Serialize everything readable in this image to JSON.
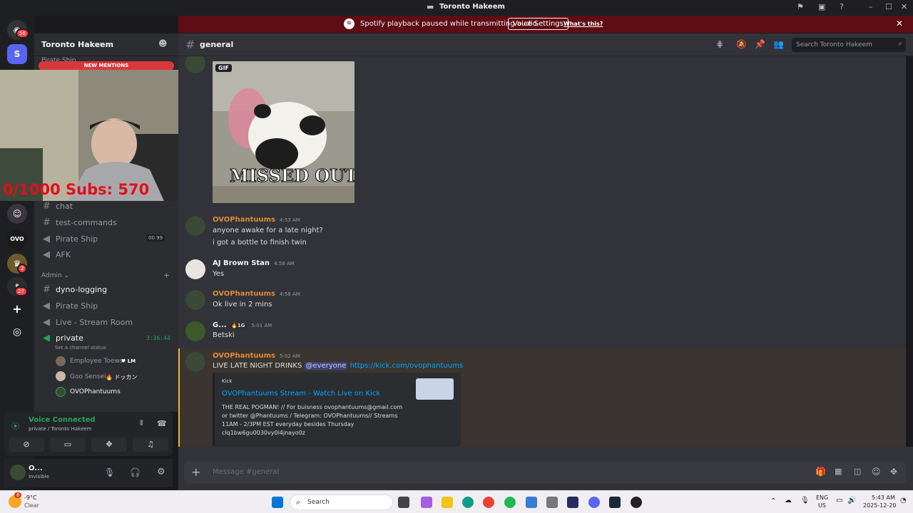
{
  "window": {
    "title": "Toronto Hakeem"
  },
  "banner": {
    "message": "Spotify playback paused while transmitting audio.",
    "button": "Voice Settings",
    "link": "What's this?"
  },
  "rail": {
    "badges": [
      "56",
      "2",
      "27"
    ]
  },
  "server": {
    "name": "Toronto Hakeem",
    "new_mentions": "NEW MENTIONS",
    "partial_label": "Pirate Ship"
  },
  "webcam": {
    "overlay_text": "0/1000 Subs: 570"
  },
  "channels": {
    "upper": [
      {
        "name": "chat",
        "type": "text"
      },
      {
        "name": "test-commands",
        "type": "text"
      },
      {
        "name": "Pirate Ship",
        "type": "voice",
        "count_a": "00",
        "count_b": "99"
      },
      {
        "name": "AFK",
        "type": "voice"
      }
    ],
    "admin_category": "Admin",
    "admin": [
      {
        "name": "dyno-logging",
        "type": "text"
      },
      {
        "name": "Pirate Ship",
        "type": "voice"
      },
      {
        "name": "Live - Stream Room",
        "type": "voice"
      },
      {
        "name": "private",
        "type": "voice",
        "timer": "3:36:44"
      }
    ],
    "set_status": "Set a channel status",
    "voice_users": [
      {
        "name": "Employee Toews",
        "tag": "LM"
      },
      {
        "name": "Goo Sensei",
        "tag": "ドッカン"
      },
      {
        "name": "OVOPhantuums",
        "tag": ""
      }
    ]
  },
  "voice_panel": {
    "status": "Voice Connected",
    "location": "private / Toronto Hakeem"
  },
  "user_panel": {
    "name": "O...",
    "status": "Invisible"
  },
  "channel": {
    "name": "general",
    "search_placeholder": "Search Toronto Hakeem",
    "composer_placeholder": "Message #general"
  },
  "messages": [
    {
      "author": "OVOPhantuums",
      "time": "4:53 AM",
      "lines": [
        "anyone awake for a late night?",
        "i got a bottle to finish twin"
      ],
      "color": "#e08a3a"
    },
    {
      "author": "AJ Brown Stan",
      "time": "4:58 AM",
      "lines": [
        "Yes"
      ],
      "color": "#f2f3f5"
    },
    {
      "author": "OVOPhantuums",
      "time": "4:58 AM",
      "lines": [
        "Ok live in 2 mins"
      ],
      "color": "#e08a3a"
    },
    {
      "author": "G...",
      "time": "5:01 AM",
      "tag": "1G",
      "lines": [
        "Betski"
      ],
      "color": "#f2f3f5"
    },
    {
      "author": "OVOPhantuums",
      "time": "5:02 AM",
      "color": "#e08a3a",
      "text": "LIVE LATE NIGHT DRINKS",
      "mention": "@everyone",
      "url": "https://kick.com/ovophantuums"
    }
  ],
  "gif": {
    "badge": "GIF",
    "caption": "MISSED OUT"
  },
  "embed": {
    "provider": "Kick",
    "title": "OVOPhantuums Stream - Watch Live on Kick",
    "description_lines": [
      "THE REAL POGMAN! // For buisness ovophantuums@gmail.com",
      "or twitter @Phantuums / Telegram: OVOPhantuums// Streams",
      "11AM - 2/3PM EST everyday besides Thursday",
      "clq1bw6gu0030vy0i4jnayo0z"
    ]
  },
  "taskbar": {
    "weather_temp": "-9°C",
    "weather_desc": "Clear",
    "weather_badge": "6",
    "search": "Search",
    "lang": "ENG",
    "region": "US",
    "time": "5:43 AM",
    "date": "2025-12-20"
  }
}
